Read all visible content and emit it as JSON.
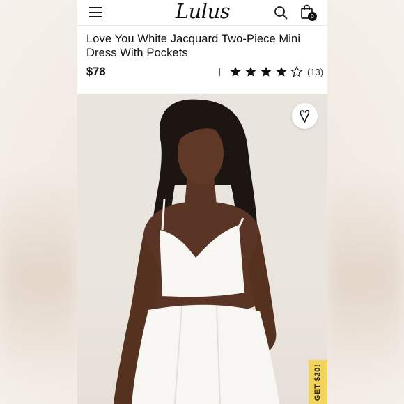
{
  "header": {
    "logo_text": "Lulus",
    "cart_count": "0",
    "icons": [
      "hamburger-menu-icon",
      "search-icon",
      "shopping-bag-icon"
    ]
  },
  "product": {
    "title": "Love You White Jacquard Two-Piece Mini Dress With Pockets",
    "price": "$78",
    "rating": 4,
    "rating_max": 5,
    "review_count": "(13)"
  },
  "photo": {
    "wishlist_icon": "heart-icon"
  },
  "promo": {
    "label": "GET $20!",
    "color": "#f2d35b"
  },
  "colors": {
    "accent_dark": "#111111",
    "background": "#ffffff"
  }
}
